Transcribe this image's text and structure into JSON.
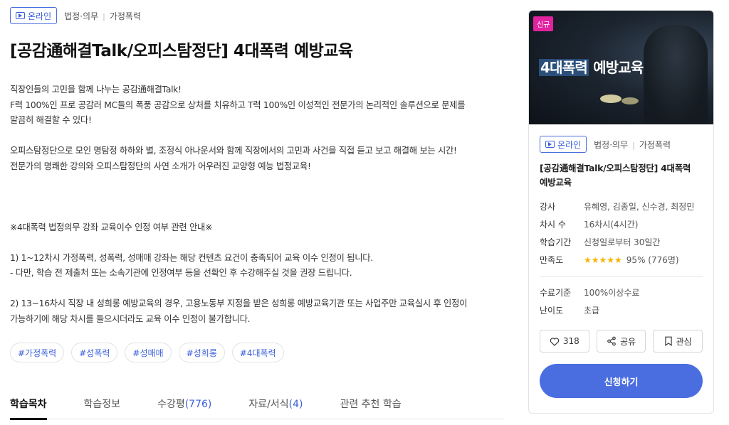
{
  "meta": {
    "badge": "온라인",
    "category": "법정·의무",
    "subcategory": "가정폭력"
  },
  "title": "[공감通해결Talk/오피스탐정단] 4대폭력 예방교육",
  "description": [
    "직장인들의 고민을 함께 나누는 공감通해결Talk!",
    "F력 100%인 프로 공감러 MC들의 폭풍 공감으로 상처를 치유하고 T력 100%인 이성적인 전문가의 논리적인 솔루션으로 문제를",
    "말끔히 해결할 수 있다!",
    "",
    "오피스탐정단으로 모인 명탐정 하하와 별, 조정식 아나운서와 함께 직장에서의 고민과 사건을 직접 듣고 보고 해결해 보는 시간!",
    "전문가의 명쾌한 강의와 오피스탐정단의 사연 소개가 어우러진 교양형 예능 법정교육!",
    "",
    "",
    "",
    "※4대폭력 법정의무 강좌 교육이수 인정 여부 관련 안내※",
    "",
    "1) 1~12차시 가정폭력, 성폭력, 성매매 강좌는 해당 컨텐츠 요건이 충족되어 교육 이수 인정이 됩니다.",
    "- 다만, 학습 전 제출처 또는 소속기관에 인정여부 등을 선확인 후 수강해주실 것을 권장 드립니다.",
    "",
    "2) 13~16차시 직장 내 성희롱 예방교육의 경우, 고용노동부 지정을 받은 성희롱 예방교육기관 또는 사업주만 교육실시 후 인정이",
    "가능하기에 해당 차시를 들으시더라도 교육 이수 인정이 불가합니다."
  ],
  "tags": [
    "#가정폭력",
    "#성폭력",
    "#성매매",
    "#성희롱",
    "#4대폭력"
  ],
  "tabs": [
    {
      "label": "학습목차",
      "count": ""
    },
    {
      "label": "학습정보",
      "count": ""
    },
    {
      "label": "수강평",
      "count": "(776)"
    },
    {
      "label": "자료/서식",
      "count": "(4)"
    },
    {
      "label": "관련 추천 학습",
      "count": ""
    }
  ],
  "card": {
    "new_badge": "신규",
    "thumb_title_highlight": "4대폭력",
    "thumb_title_rest": " 예방교육",
    "title_line1": "[공감通해결Talk/오피스탐정단] 4대폭력",
    "title_line2": "예방교육",
    "info": [
      {
        "key": "강사",
        "value": "유혜영, 김종일, 신수경, 최정민"
      },
      {
        "key": "차시 수",
        "value": "16차시(4시간)"
      },
      {
        "key": "학습기간",
        "value": "신청일로부터 30일간"
      },
      {
        "key": "만족도",
        "value": "95% (776명)",
        "rating": 4.5
      }
    ],
    "info2": [
      {
        "key": "수료기준",
        "value": "100%이상수료"
      },
      {
        "key": "난이도",
        "value": "초급"
      }
    ],
    "like_count": "318",
    "share_label": "공유",
    "bookmark_label": "관심",
    "apply_label": "신청하기",
    "stars": "★★★★★"
  },
  "colors": {
    "accent": "#4a6ee0",
    "new_badge": "#e2239f",
    "star": "#f5b400"
  }
}
